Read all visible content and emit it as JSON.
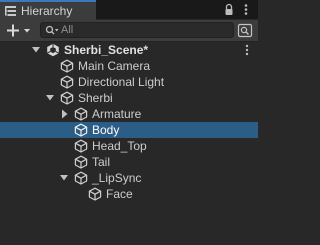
{
  "window": {
    "tab_title": "Hierarchy"
  },
  "toolbar": {
    "search_placeholder": "All"
  },
  "hierarchy": {
    "scene": {
      "label": "Sherbi_Scene*"
    },
    "items": [
      {
        "label": "Main Camera",
        "depth": 1,
        "expandable": false,
        "expanded": false,
        "selected": false
      },
      {
        "label": "Directional Light",
        "depth": 1,
        "expandable": false,
        "expanded": false,
        "selected": false
      },
      {
        "label": "Sherbi",
        "depth": 1,
        "expandable": true,
        "expanded": true,
        "selected": false
      },
      {
        "label": "Armature",
        "depth": 2,
        "expandable": true,
        "expanded": false,
        "selected": false
      },
      {
        "label": "Body",
        "depth": 2,
        "expandable": false,
        "expanded": false,
        "selected": true
      },
      {
        "label": "Head_Top",
        "depth": 2,
        "expandable": false,
        "expanded": false,
        "selected": false
      },
      {
        "label": "Tail",
        "depth": 2,
        "expandable": false,
        "expanded": false,
        "selected": false
      },
      {
        "label": "_LipSync",
        "depth": 2,
        "expandable": true,
        "expanded": true,
        "selected": false
      },
      {
        "label": "Face",
        "depth": 3,
        "expandable": false,
        "expanded": false,
        "selected": false
      }
    ]
  },
  "colors": {
    "selection": "#2c5d87",
    "tab_accent": "#3a79bb"
  }
}
